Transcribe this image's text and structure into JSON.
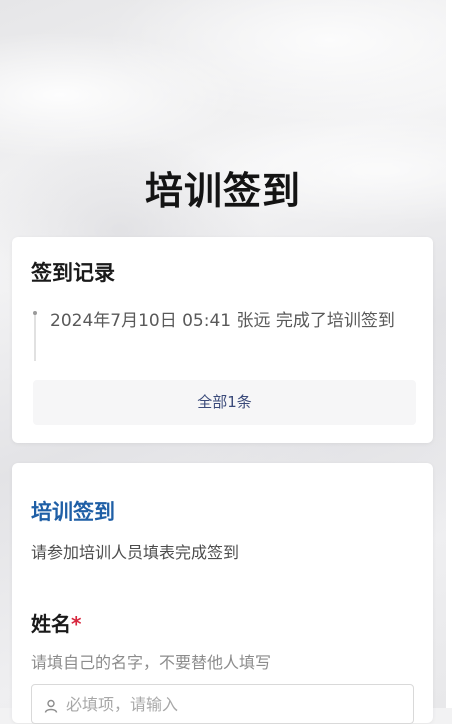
{
  "page": {
    "title": "培训签到"
  },
  "records": {
    "title": "签到记录",
    "items": [
      {
        "text": "2024年7月10日 05:41  张远 完成了培训签到"
      }
    ],
    "all_button_label": "全部1条"
  },
  "form": {
    "title": "培训签到",
    "description": "请参加培训人员填表完成签到",
    "fields": [
      {
        "label": "姓名",
        "required_mark": "*",
        "hint": "请填自己的名字，不要替他人填写",
        "placeholder": "必填项，请输入",
        "icon": "person-icon"
      }
    ]
  },
  "colors": {
    "form_title": "#1f5fa6",
    "required": "#d7263d",
    "all_button_text": "#3a4a7a"
  }
}
